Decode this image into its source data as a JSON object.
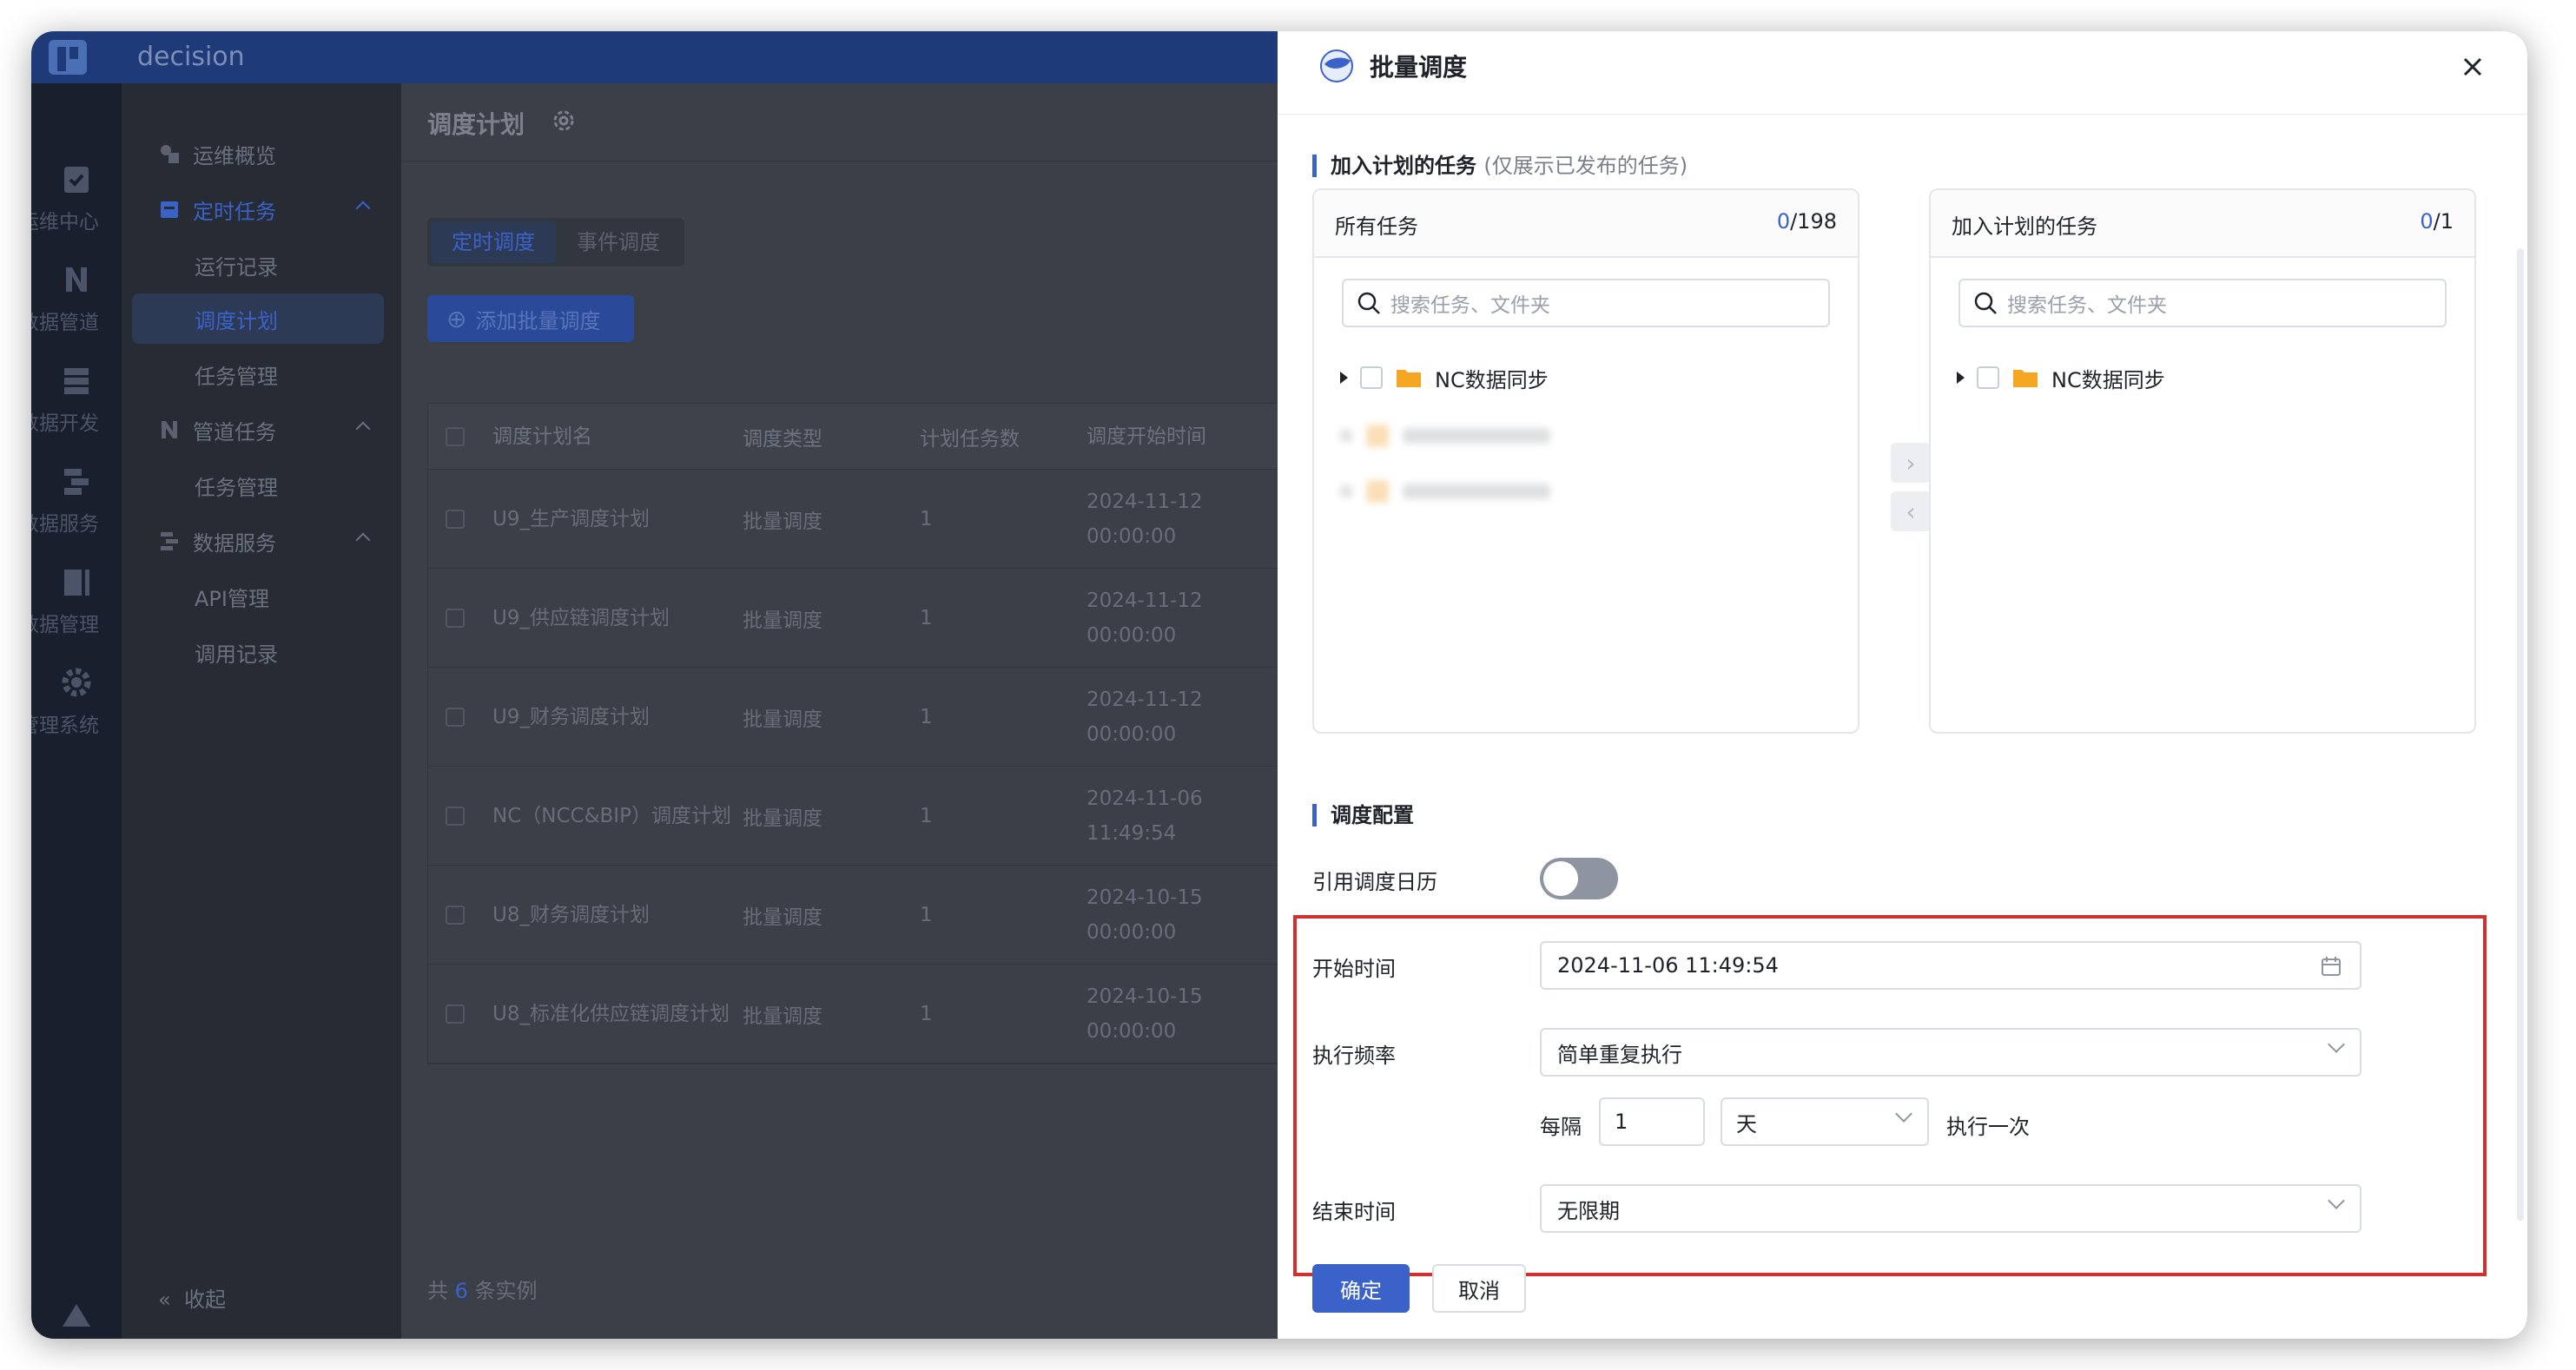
{
  "app": {
    "name": "decision"
  },
  "rail": [
    "运维中心",
    "数据管道",
    "数据开发",
    "数据服务",
    "数据管理",
    "管理系统"
  ],
  "subnav": {
    "overview": "运维概览",
    "timed_tasks": "定时任务",
    "run_records": "运行记录",
    "schedule_plan": "调度计划",
    "task_mgmt_1": "任务管理",
    "pipeline_tasks": "管道任务",
    "task_mgmt_2": "任务管理",
    "data_service": "数据服务",
    "api_mgmt": "API管理",
    "call_records": "调用记录",
    "collapse": "收起"
  },
  "main": {
    "title": "调度计划",
    "tabs": [
      "定时调度",
      "事件调度"
    ],
    "add_button": "添加批量调度",
    "columns": [
      "调度计划名",
      "调度类型",
      "计划任务数",
      "调度开始时间"
    ],
    "rows": [
      {
        "name": "U9_生产调度计划",
        "type": "批量调度",
        "count": "1",
        "start": "2024-11-12 00:00:00"
      },
      {
        "name": "U9_供应链调度计划",
        "type": "批量调度",
        "count": "1",
        "start": "2024-11-12 00:00:00"
      },
      {
        "name": "U9_财务调度计划",
        "type": "批量调度",
        "count": "1",
        "start": "2024-11-12 00:00:00"
      },
      {
        "name": "NC（NCC&BIP）调度计划",
        "type": "批量调度",
        "count": "1",
        "start": "2024-11-06 11:49:54"
      },
      {
        "name": "U8_财务调度计划",
        "type": "批量调度",
        "count": "1",
        "start": "2024-10-15 00:00:00"
      },
      {
        "name": "U8_标准化供应链调度计划",
        "type": "批量调度",
        "count": "1",
        "start": "2024-10-15 00:00:00"
      }
    ],
    "total_prefix": "共",
    "total_count": "6",
    "total_suffix": "条实例"
  },
  "drawer": {
    "title": "批量调度",
    "section_tasks": "加入计划的任务",
    "section_tasks_hint": "(仅展示已发布的任务)",
    "left_panel": {
      "title": "所有任务",
      "selected": "0",
      "total": "/198",
      "search_placeholder": "搜索任务、文件夹",
      "folder": "NC数据同步"
    },
    "right_panel": {
      "title": "加入计划的任务",
      "selected": "0",
      "total": "/1",
      "search_placeholder": "搜索任务、文件夹",
      "folder": "NC数据同步"
    },
    "section_config": "调度配置",
    "calendar_label": "引用调度日历",
    "calendar_enabled": false,
    "start_label": "开始时间",
    "start_value": "2024-11-06 11:49:54",
    "freq_label": "执行频率",
    "freq_value": "简单重复执行",
    "every_label": "每隔",
    "every_value": "1",
    "unit_value": "天",
    "exec_once": "执行一次",
    "end_label": "结束时间",
    "end_value": "无限期",
    "confirm": "确定",
    "cancel": "取消"
  },
  "colors": {
    "accent": "#3a62c8",
    "highlight": "#d32f2f"
  }
}
